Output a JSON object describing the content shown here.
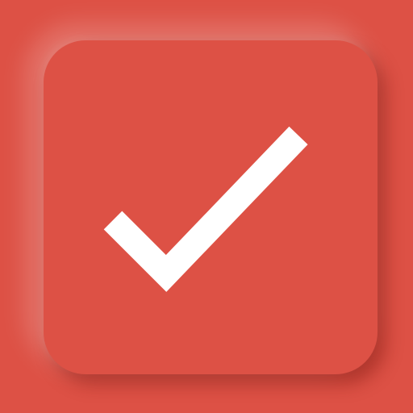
{
  "app": {
    "icon": "checkmark-icon",
    "colors": {
      "background": "#DD5145",
      "tile": "#DD5145",
      "check": "#FFFFFF"
    }
  }
}
